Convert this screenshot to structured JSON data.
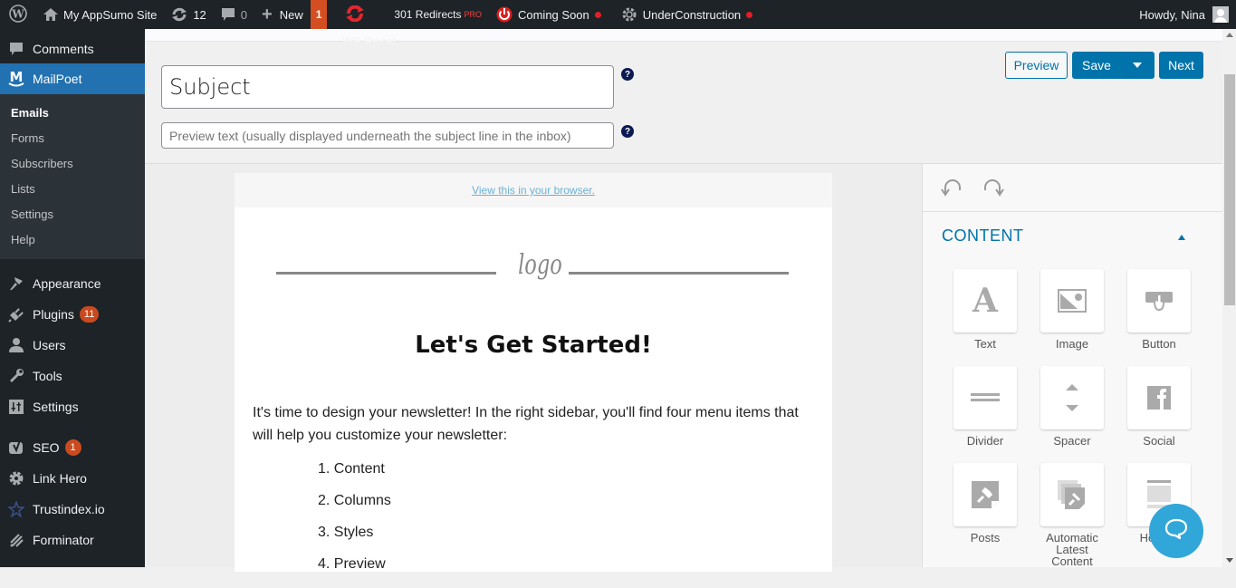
{
  "adminbar": {
    "site_name": "My AppSumo Site",
    "updates_count": "12",
    "comments_count": "0",
    "new_label": "New",
    "notification_count": "1",
    "redirects_label": "301 Redirects",
    "redirects_badge": "PRO",
    "coming_soon_label": "Coming Soon",
    "under_construction_label": "UnderConstruction",
    "howdy": "Howdy, Nina"
  },
  "sidebar": {
    "items_top": [
      {
        "label": "Comments",
        "icon": "comment-icon"
      },
      {
        "label": "MailPoet",
        "icon": "mailpoet-icon",
        "current": true
      }
    ],
    "submenu": [
      {
        "label": "Emails",
        "active": true
      },
      {
        "label": "Forms"
      },
      {
        "label": "Subscribers"
      },
      {
        "label": "Lists"
      },
      {
        "label": "Settings"
      },
      {
        "label": "Help"
      }
    ],
    "items_bottom": [
      {
        "label": "Appearance",
        "icon": "paintbrush-icon"
      },
      {
        "label": "Plugins",
        "icon": "plugin-icon",
        "badge": "11"
      },
      {
        "label": "Users",
        "icon": "users-icon"
      },
      {
        "label": "Tools",
        "icon": "wrench-icon"
      },
      {
        "label": "Settings",
        "icon": "settings-icon"
      },
      {
        "label": "SEO",
        "icon": "yoast-icon",
        "badge": "1"
      },
      {
        "label": "Link Hero",
        "icon": "gear-icon"
      },
      {
        "label": "Trustindex.io",
        "icon": "star-icon"
      },
      {
        "label": "Forminator",
        "icon": "forminator-icon"
      }
    ]
  },
  "header": {
    "ghost_text": "WP Reset",
    "subject_value": "Subject",
    "preview_placeholder": "Preview text (usually displayed underneath the subject line in the inbox)",
    "help_glyph": "?",
    "buttons": {
      "preview": "Preview",
      "save": "Save",
      "next": "Next"
    }
  },
  "email": {
    "view_in_browser": "View this in your browser.",
    "logo_text": "logo",
    "headline": "Let's Get Started!",
    "intro": "It's time to design your newsletter! In the right sidebar, you'll find four menu items that will help you customize your newsletter:",
    "steps": [
      "1. Content",
      "2. Columns",
      "3. Styles",
      "4. Preview"
    ]
  },
  "editor_sidebar": {
    "section_title": "CONTENT",
    "widgets": [
      {
        "label": "Text",
        "icon": "text-icon"
      },
      {
        "label": "Image",
        "icon": "image-icon"
      },
      {
        "label": "Button",
        "icon": "button-icon"
      },
      {
        "label": "Divider",
        "icon": "divider-icon"
      },
      {
        "label": "Spacer",
        "icon": "spacer-icon"
      },
      {
        "label": "Social",
        "icon": "facebook-icon"
      },
      {
        "label": "Posts",
        "icon": "pin-icon"
      },
      {
        "label": "Automatic Latest Content",
        "icon": "pin-stack-icon"
      },
      {
        "label": "Header",
        "icon": "header-icon"
      }
    ]
  },
  "colors": {
    "accent": "#0073aa",
    "wp_blue": "#2271b1",
    "chat": "#30a7d8",
    "badge": "#ca4a1f"
  }
}
